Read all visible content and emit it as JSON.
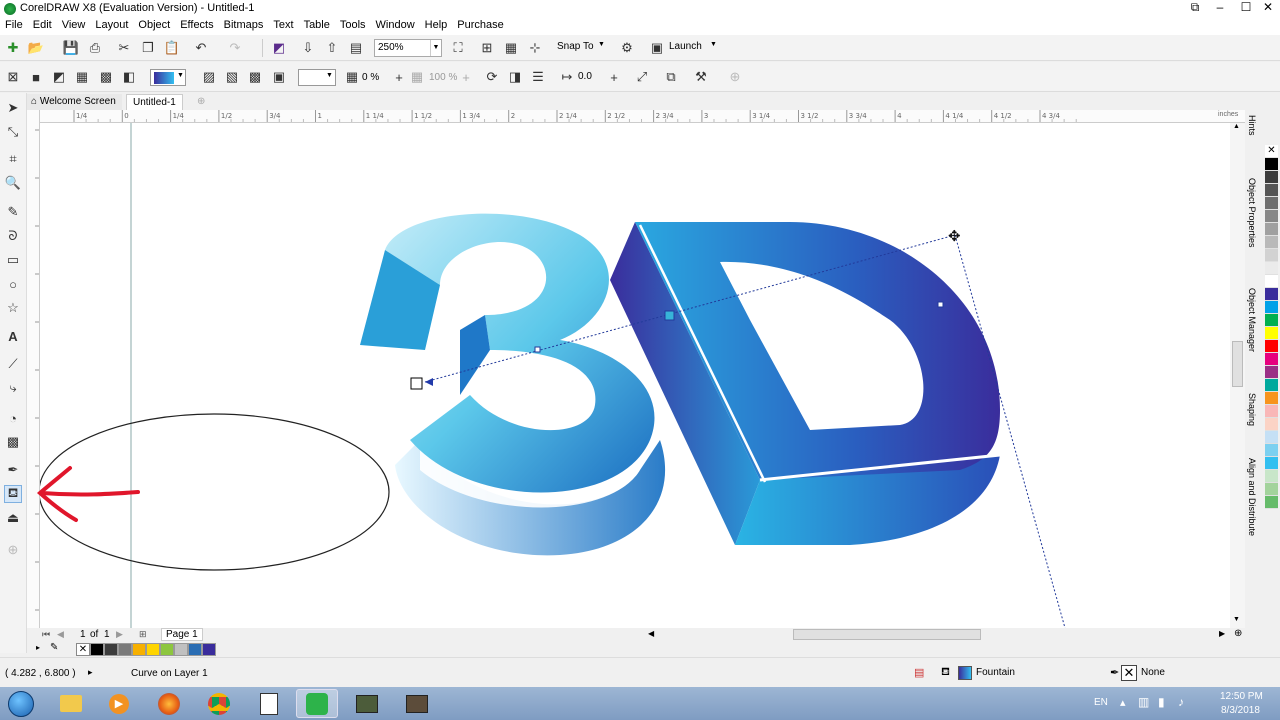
{
  "window": {
    "title": "CorelDRAW X8 (Evaluation Version) - Untitled-1"
  },
  "menu": [
    "File",
    "Edit",
    "View",
    "Layout",
    "Object",
    "Effects",
    "Bitmaps",
    "Text",
    "Table",
    "Tools",
    "Window",
    "Help",
    "Purchase"
  ],
  "toolbar1": {
    "zoom": "250%",
    "snap_to": "Snap To",
    "launch": "Launch"
  },
  "toolbar2": {
    "transparency": "0 %",
    "opacity_disabled": "100 %",
    "angle": "0.0"
  },
  "tabs": {
    "welcome": "Welcome Screen",
    "doc": "Untitled-1"
  },
  "ruler": {
    "unit": "inches",
    "labels_h": [
      "1/4",
      "0",
      "1/4",
      "1/2",
      "3/4",
      "1",
      "1 1/4",
      "1 1/2",
      "1 3/4",
      "2",
      "2 1/4",
      "2 1/2",
      "2 3/4",
      "3",
      "3 1/4",
      "3 1/2",
      "3 3/4",
      "4",
      "4 1/4",
      "4 1/2",
      "4 3/4"
    ]
  },
  "artwork": {
    "text": "3D"
  },
  "pagenav": {
    "current": "1",
    "of": "of",
    "total": "1",
    "page_tab": "Page 1"
  },
  "status": {
    "coords": "( 4.282 , 6.800 )",
    "object": "Curve on Layer 1",
    "fill": "Fountain",
    "outline": "None"
  },
  "dockers": [
    "Hints",
    "Object Properties",
    "Object Manager",
    "Shaping",
    "Align and Distribute"
  ],
  "colors": {
    "palette": [
      "#000000",
      "#3c3c3c",
      "#555555",
      "#6e6e6e",
      "#878787",
      "#a0a0a0",
      "#b9b9b9",
      "#d2d2d2",
      "#ebebeb",
      "#ffffff",
      "#3a2d9c",
      "#00a2e8",
      "#00b050",
      "#ffff00",
      "#ff0000",
      "#e6007e",
      "#9b2f86",
      "#00a99d",
      "#f7941d",
      "#f9b7b7",
      "#fbd3c5",
      "#c5e0f5",
      "#7cd0f0",
      "#33bff0",
      "#c8e6c9",
      "#a3d39c",
      "#66bb6a"
    ],
    "doc_palette": [
      "#000000",
      "#3c3c3c",
      "#7a7a7a",
      "#f7b000",
      "#ffd500",
      "#8dc63f",
      "#c0c0c0",
      "#2a6db3",
      "#3a2d9c"
    ]
  },
  "taskbar": {
    "lang": "EN",
    "time": "12:50 PM",
    "date": "8/3/2018"
  }
}
